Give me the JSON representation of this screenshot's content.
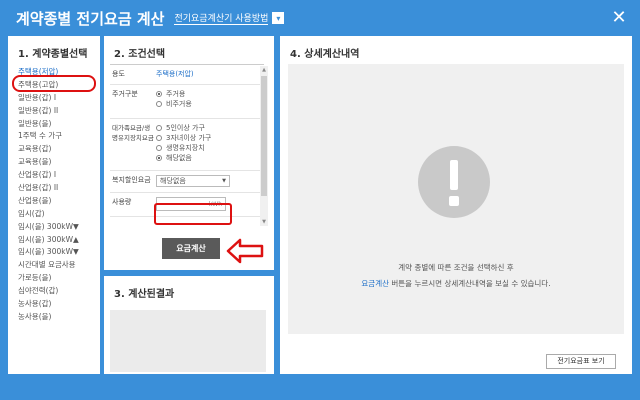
{
  "window": {
    "title": "계약종별 전기요금 계산",
    "help_link": "전기요금계산기 사용방법",
    "help_arrow": "▾",
    "close": "✕"
  },
  "panel1": {
    "title": "1. 계약종별선택",
    "items": [
      "주택용(저압)",
      "주택용(고압)",
      "일반용(갑) I",
      "일반용(갑) II",
      "일반용(을)",
      "1주택 수 가구",
      "교육용(갑)",
      "교육용(을)",
      "산업용(갑) I",
      "산업용(갑) II",
      "산업용(을)",
      "임시(갑)",
      "임시(을) 300kW▼",
      "임시(을) 300kW▲",
      "임시(을) 300kW▼",
      "시간대별 요금사용",
      "가로등(을)",
      "심야전력(갑)",
      "농사용(갑)",
      "농사용(을)"
    ]
  },
  "panel2": {
    "title": "2. 조건선택",
    "usage_label": "용도",
    "usage_value": "주택용(저압)",
    "residence_label": "주거구분",
    "residence_options": [
      "주거용",
      "비주거용"
    ],
    "family_label": "대가족요금/생명유지장치요금",
    "family_options": [
      "5인이상 가구",
      "3자녀이상 가구",
      "생명유지장치",
      "해당없음"
    ],
    "welfare_label": "복지할인요금",
    "welfare_value": "해당없음",
    "amount_label": "사용량",
    "amount_unit": "kWh",
    "calc_button": "요금계산"
  },
  "panel3": {
    "title": "3. 계산된결과"
  },
  "panel4": {
    "title": "4. 상세계산내역",
    "msg1": "계약 종별에 따른 조건을 선택하신 후",
    "msg2_hl": "요금계산",
    "msg2_rest": " 버튼을 누르시면 상세계산내역을 보실 수 있습니다.",
    "table_button": "전기요금표 보기"
  },
  "colors": {
    "header": "#3a8fd9",
    "highlight": "#d11111",
    "link": "#1e6fc8"
  }
}
